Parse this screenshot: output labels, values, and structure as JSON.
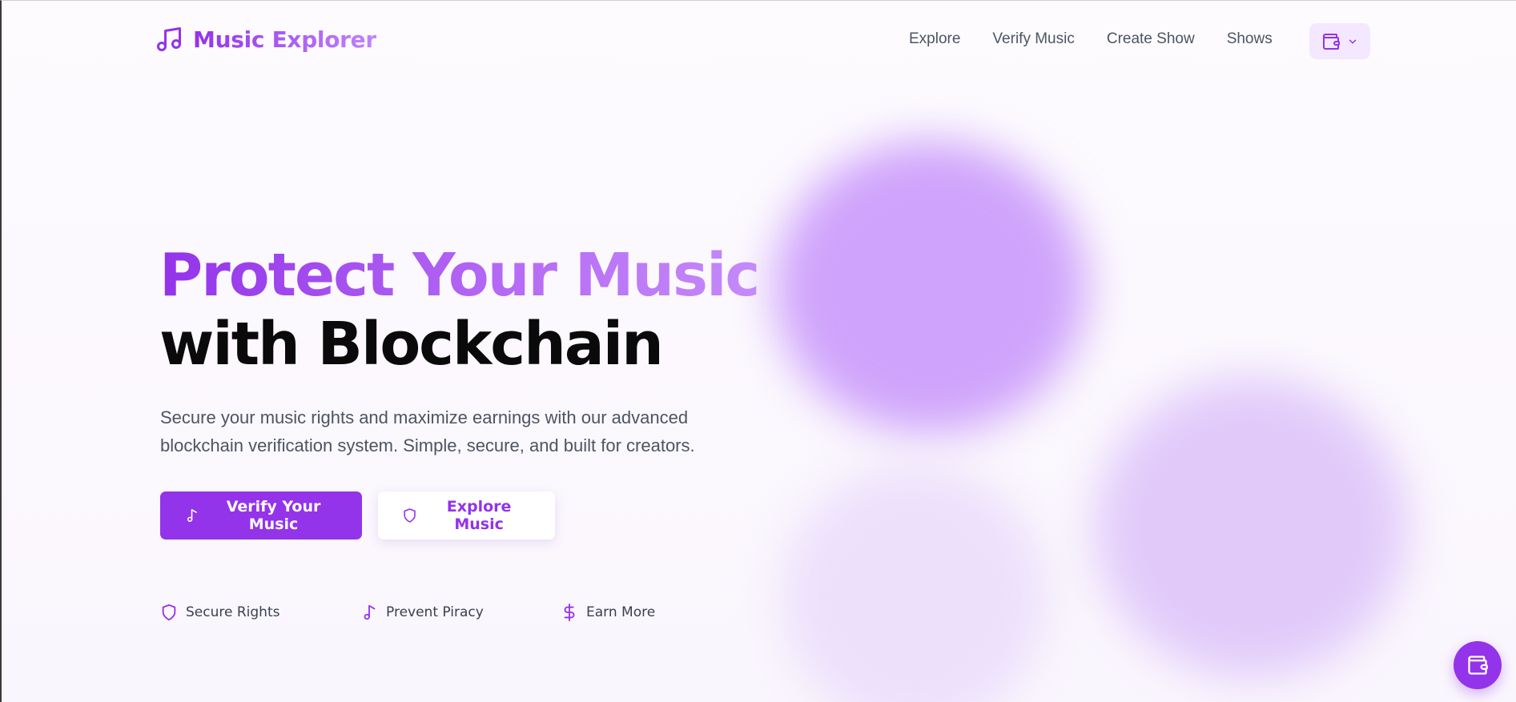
{
  "brand": {
    "name": "Music Explorer",
    "icon": "music-note-icon",
    "color": "#9333ea"
  },
  "nav": {
    "links": [
      "Explore",
      "Verify Music",
      "Create Show",
      "Shows"
    ],
    "wallet_icon": "wallet-icon",
    "dropdown_icon": "chevron-down-icon"
  },
  "hero": {
    "title_line_1": "Protect Your Music",
    "title_line_2": "with Blockchain",
    "description": "Secure your music rights and maximize earnings with our advanced blockchain verification system. Simple, secure, and built for creators.",
    "primary_button": {
      "label": "Verify Your Music",
      "icon": "music-note-icon"
    },
    "secondary_button": {
      "label": "Explore Music",
      "icon": "shield-icon"
    }
  },
  "features": [
    {
      "label": "Secure Rights",
      "icon": "shield-icon"
    },
    {
      "label": "Prevent Piracy",
      "icon": "music-note-icon"
    },
    {
      "label": "Earn More",
      "icon": "dollar-icon"
    }
  ],
  "floating_button": {
    "icon": "wallet-icon"
  },
  "colors": {
    "accent": "#9333ea",
    "accent_light": "#c084fc",
    "wallet_bg": "#f3e8ff"
  }
}
